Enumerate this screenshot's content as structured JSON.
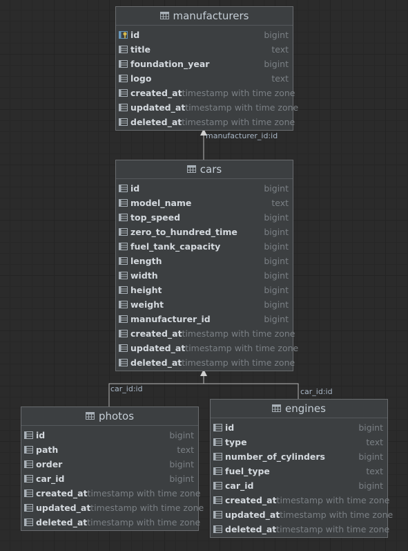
{
  "tables": {
    "manufacturers": {
      "name": "manufacturers",
      "columns": [
        {
          "name": "id",
          "type": "bigint",
          "key": true
        },
        {
          "name": "title",
          "type": "text"
        },
        {
          "name": "foundation_year",
          "type": "bigint"
        },
        {
          "name": "logo",
          "type": "text"
        },
        {
          "name": "created_at",
          "type": "timestamp with time zone"
        },
        {
          "name": "updated_at",
          "type": "timestamp with time zone"
        },
        {
          "name": "deleted_at",
          "type": "timestamp with time zone"
        }
      ]
    },
    "cars": {
      "name": "cars",
      "columns": [
        {
          "name": "id",
          "type": "bigint"
        },
        {
          "name": "model_name",
          "type": "text"
        },
        {
          "name": "top_speed",
          "type": "bigint"
        },
        {
          "name": "zero_to_hundred_time",
          "type": "bigint"
        },
        {
          "name": "fuel_tank_capacity",
          "type": "bigint"
        },
        {
          "name": "length",
          "type": "bigint"
        },
        {
          "name": "width",
          "type": "bigint"
        },
        {
          "name": "height",
          "type": "bigint"
        },
        {
          "name": "weight",
          "type": "bigint"
        },
        {
          "name": "manufacturer_id",
          "type": "bigint"
        },
        {
          "name": "created_at",
          "type": "timestamp with time zone"
        },
        {
          "name": "updated_at",
          "type": "timestamp with time zone"
        },
        {
          "name": "deleted_at",
          "type": "timestamp with time zone"
        }
      ]
    },
    "photos": {
      "name": "photos",
      "columns": [
        {
          "name": "id",
          "type": "bigint"
        },
        {
          "name": "path",
          "type": "text"
        },
        {
          "name": "order",
          "type": "bigint"
        },
        {
          "name": "car_id",
          "type": "bigint"
        },
        {
          "name": "created_at",
          "type": "timestamp with time zone"
        },
        {
          "name": "updated_at",
          "type": "timestamp with time zone"
        },
        {
          "name": "deleted_at",
          "type": "timestamp with time zone"
        }
      ]
    },
    "engines": {
      "name": "engines",
      "columns": [
        {
          "name": "id",
          "type": "bigint"
        },
        {
          "name": "type",
          "type": "text"
        },
        {
          "name": "number_of_cylinders",
          "type": "bigint"
        },
        {
          "name": "fuel_type",
          "type": "text"
        },
        {
          "name": "car_id",
          "type": "bigint"
        },
        {
          "name": "created_at",
          "type": "timestamp with time zone"
        },
        {
          "name": "updated_at",
          "type": "timestamp with time zone"
        },
        {
          "name": "deleted_at",
          "type": "timestamp with time zone"
        }
      ]
    }
  },
  "relations": {
    "cars_manufacturers": "manufacturer_id:id",
    "photos_cars": "car_id:id",
    "engines_cars": "car_id:id"
  },
  "colors": {
    "background": "#2b2b2b",
    "table_bg": "#3c3f41",
    "edge": "#b8b8b8"
  }
}
